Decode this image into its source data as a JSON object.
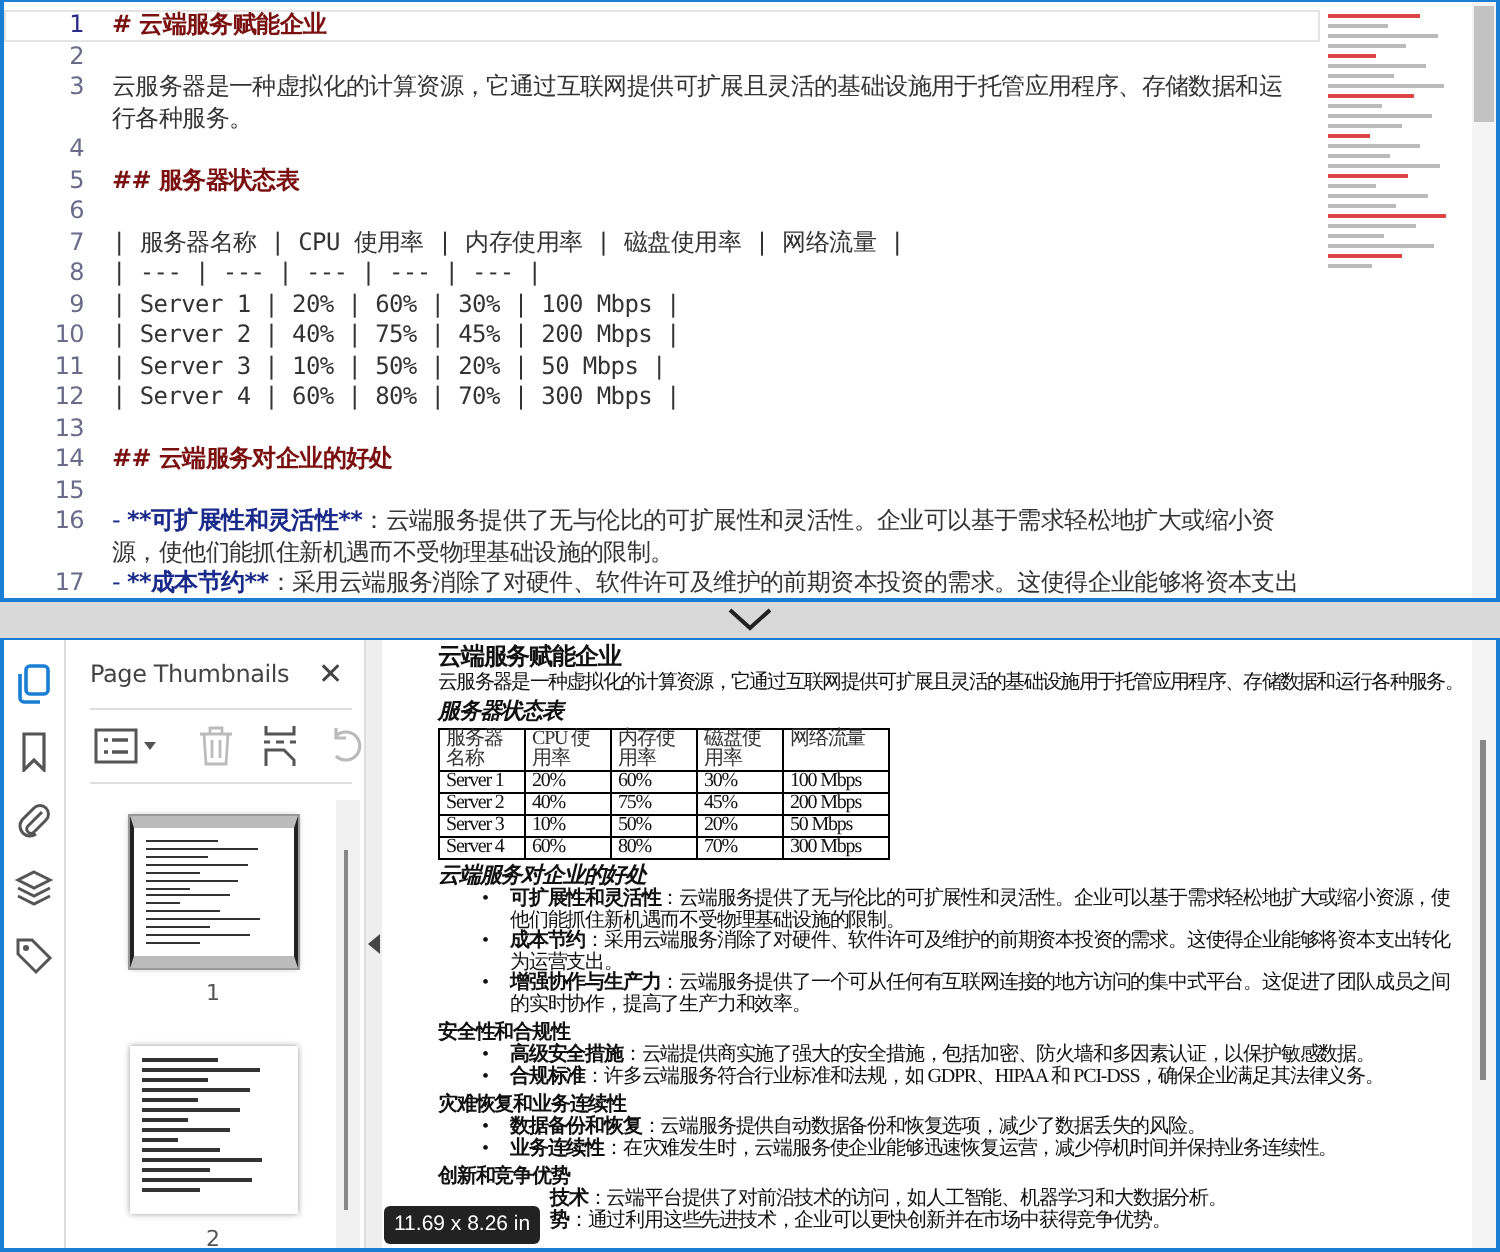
{
  "editor": {
    "lines": [
      {
        "number": "1",
        "kind": "h1",
        "text": "# 云端服务赋能企业",
        "current": true
      },
      {
        "number": "2",
        "kind": "blank",
        "current": false
      },
      {
        "number": "3",
        "kind": "text",
        "text": "云服务器是一种虚拟化的计算资源，它通过互联网提供可扩展且灵活的基础设施用于托管应用程序、存储数据和运行各种服务。",
        "current": false
      },
      {
        "number": "4",
        "kind": "blank",
        "current": false
      },
      {
        "number": "5",
        "kind": "h2",
        "text": "## 服务器状态表",
        "current": false
      },
      {
        "number": "6",
        "kind": "blank",
        "current": false
      },
      {
        "number": "7",
        "kind": "code",
        "text": "| 服务器名称 | CPU 使用率 | 内存使用率 | 磁盘使用率 | 网络流量 |",
        "current": false
      },
      {
        "number": "8",
        "kind": "code",
        "text": "| --- | --- | --- | --- | --- |",
        "current": false
      },
      {
        "number": "9",
        "kind": "code",
        "text": "| Server 1 | 20% | 60% | 30% | 100 Mbps |",
        "current": false
      },
      {
        "number": "10",
        "kind": "code",
        "text": "| Server 2 | 40% | 75% | 45% | 200 Mbps |",
        "current": false
      },
      {
        "number": "11",
        "kind": "code",
        "text": "| Server 3 | 10% | 50% | 20% | 50 Mbps |",
        "current": false
      },
      {
        "number": "12",
        "kind": "code",
        "text": "| Server 4 | 60% | 80% | 70% | 300 Mbps |",
        "current": false
      },
      {
        "number": "13",
        "kind": "blank",
        "current": false
      },
      {
        "number": "14",
        "kind": "h2",
        "text": "## 云端服务对企业的好处",
        "current": false
      },
      {
        "number": "15",
        "kind": "blank",
        "current": false
      },
      {
        "number": "16",
        "kind": "bullet",
        "marker": "- ",
        "strong": "**可扩展性和灵活性**",
        "text": "：云端服务提供了无与伦比的可扩展性和灵活性。企业可以基于需求轻松地扩大或缩小资源，使他们能抓住新机遇而不受物理基础设施的限制。",
        "current": false
      },
      {
        "number": "17",
        "kind": "bullet",
        "marker": "- ",
        "strong": "**成本节约**",
        "text": "：采用云端服务消除了对硬件、软件许可及维护的前期资本投资的需求。这使得企业能够将资本支出",
        "current": false
      }
    ]
  },
  "sidebar": {
    "tools": [
      {
        "kind": "pages",
        "selected": true
      },
      {
        "kind": "bookmark",
        "selected": false
      },
      {
        "kind": "attachment",
        "selected": false
      },
      {
        "kind": "layers",
        "selected": false
      },
      {
        "kind": "tag",
        "selected": false
      }
    ]
  },
  "thumbnails_panel": {
    "title": "Page Thumbnails",
    "close": "✕",
    "toolbar": [
      {
        "kind": "options",
        "disabled": false
      },
      {
        "kind": "delete",
        "disabled": true
      },
      {
        "kind": "insert",
        "disabled": false
      },
      {
        "kind": "rotate",
        "disabled": true
      }
    ],
    "pages": [
      {
        "label": "1",
        "selected": true
      },
      {
        "label": "2",
        "selected": false
      }
    ]
  },
  "pdf": {
    "title": "云端服务赋能企业",
    "intro": "云服务器是一种虚拟化的计算资源，它通过互联网提供可扩展且灵活的基础设施用于托管应用程序、存储数据和运行各种服务。",
    "table_heading": "服务器状态表",
    "table": {
      "columns": [
        "服务器名称",
        "CPU 使用率",
        "内存使用率",
        "磁盘使用率",
        "网络流量"
      ],
      "rows": [
        [
          "Server 1",
          "20%",
          "60%",
          "30%",
          "100 Mbps"
        ],
        [
          "Server 2",
          "40%",
          "75%",
          "45%",
          "200 Mbps"
        ],
        [
          "Server 3",
          "10%",
          "50%",
          "20%",
          "50 Mbps"
        ],
        [
          "Server 4",
          "60%",
          "80%",
          "70%",
          "300 Mbps"
        ]
      ]
    },
    "sections": [
      {
        "kind": "italic",
        "heading": "云端服务对企业的好处",
        "items": [
          {
            "kind": "full",
            "marker": "•",
            "term": "可扩展性和灵活性",
            "text": "：云端服务提供了无与伦比的可扩展性和灵活性。企业可以基于需求轻松地扩大或缩小资源，使他们能抓住新机遇而不受物理基础设施的限制。"
          },
          {
            "kind": "full",
            "marker": "•",
            "term": "成本节约",
            "text": "：采用云端服务消除了对硬件、软件许可及维护的前期资本投资的需求。这使得企业能够将资本支出转化为运营支出。"
          },
          {
            "kind": "full",
            "marker": "•",
            "term": "增强协作与生产力",
            "text": "：云端服务提供了一个可从任何有互联网连接的地方访问的集中式平台。这促进了团队成员之间的实时协作，提高了生产力和效率。"
          }
        ]
      },
      {
        "kind": "plain",
        "heading": "安全性和合规性",
        "items": [
          {
            "kind": "full",
            "marker": "•",
            "term": "高级安全措施",
            "text": "：云端提供商实施了强大的安全措施，包括加密、防火墙和多因素认证，以保护敏感数据。"
          },
          {
            "kind": "full",
            "marker": "•",
            "term": "合规标准",
            "text": "：许多云端服务符合行业标准和法规，如 GDPR、HIPAA 和 PCI-DSS，确保企业满足其法律义务。"
          }
        ]
      },
      {
        "kind": "plain",
        "heading": "灾难恢复和业务连续性",
        "items": [
          {
            "kind": "full",
            "marker": "•",
            "term": "数据备份和恢复",
            "text": "：云端服务提供自动数据备份和恢复选项，减少了数据丢失的风险。"
          },
          {
            "kind": "full",
            "marker": "•",
            "term": "业务连续性",
            "text": "：在灾难发生时，云端服务使企业能够迅速恢复运营，减少停机时间并保持业务连续性。"
          }
        ]
      },
      {
        "kind": "plain",
        "heading": "创新和竞争优势",
        "items": [
          {
            "kind": "covered",
            "term": "技术",
            "text": "：云端平台提供了对前沿技术的访问，如人工智能、机器学习和大数据分析。"
          },
          {
            "kind": "covered",
            "term": "势",
            "text": "：通过利用这些先进技术，企业可以更快创新并在市场中获得竞争优势。"
          }
        ]
      }
    ]
  },
  "page_size_tooltip": "11.69 x 8.26 in"
}
